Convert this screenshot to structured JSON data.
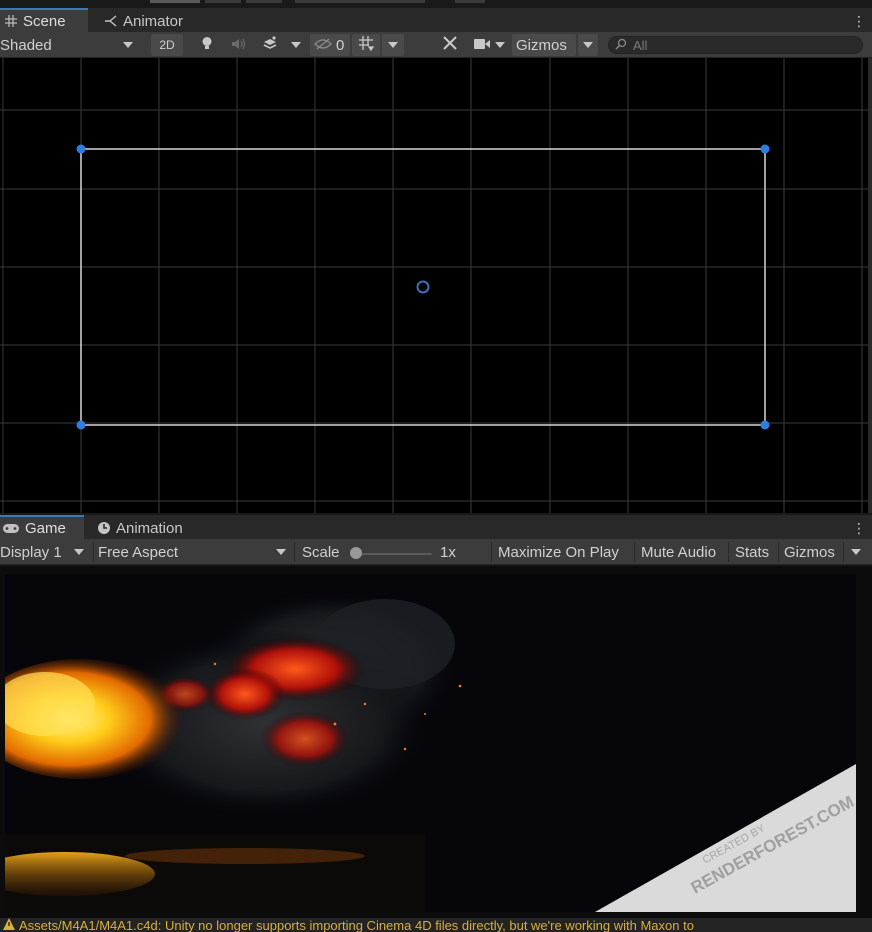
{
  "scene_tabs": [
    {
      "label": "Scene",
      "icon": "grid-icon",
      "active": true
    },
    {
      "label": "Animator",
      "icon": "animator-icon",
      "active": false
    }
  ],
  "scene_toolbar": {
    "draw_mode": "Shaded",
    "mode_2d": "2D",
    "hidden_count": "0",
    "gizmos": "Gizmos",
    "search_placeholder": "All"
  },
  "game_tabs": [
    {
      "label": "Game",
      "icon": "gamepad-icon",
      "active": true
    },
    {
      "label": "Animation",
      "icon": "clock-icon",
      "active": false
    }
  ],
  "game_toolbar": {
    "display": "Display 1",
    "aspect": "Free Aspect",
    "scale_label": "Scale",
    "scale_value": "1x",
    "scale_fraction": 0.0,
    "maximize": "Maximize On Play",
    "mute": "Mute Audio",
    "stats": "Stats",
    "gizmos": "Gizmos"
  },
  "watermark": {
    "line1": "CREATED BY",
    "line2": "RENDERFOREST.COM"
  },
  "console_message": "Assets/M4A1/M4A1.c4d: Unity no longer supports importing Cinema 4D files directly, but we're working with Maxon to",
  "colors": {
    "accent": "#3a79bb",
    "handle": "#2f7de1",
    "warning": "#d8b03a",
    "panel": "#3c3c3c",
    "tabbar": "#282828"
  }
}
